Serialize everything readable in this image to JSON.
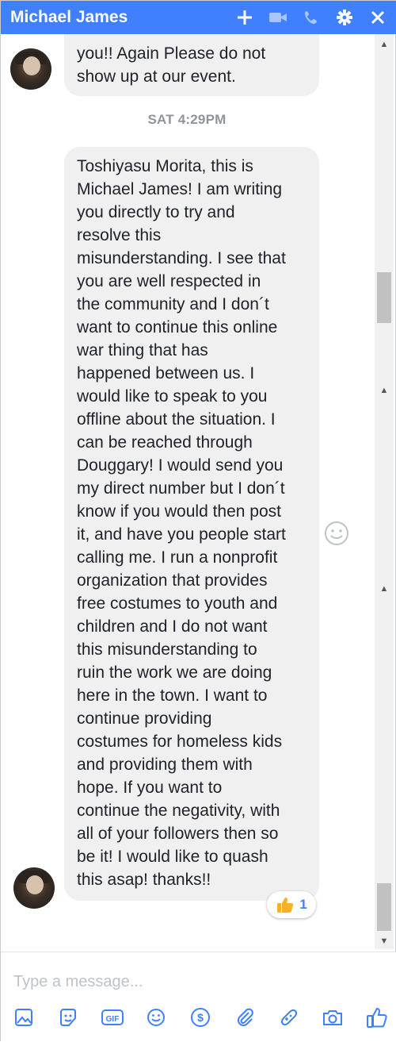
{
  "header": {
    "title": "Michael James",
    "icons": [
      "add-icon",
      "video-call-icon",
      "phone-call-icon",
      "settings-gear-icon",
      "close-icon"
    ]
  },
  "colors": {
    "header_bg": "#4080ff",
    "bubble_bg": "#f1f0f0",
    "accent": "#4080ff",
    "timestamp": "#90949c"
  },
  "conversation": {
    "previous_message": "you!! Again Please do not\nshow up at our event.",
    "timestamp": "SAT 4:29PM",
    "main_message": "Toshiyasu Morita, this is\nMichael James! I am writing\nyou directly to try and\nresolve this\nmisunderstanding. I see that\nyou are well respected in\nthe community and I don´t\nwant to continue this online\nwar thing that has\nhappened between us. I\nwould like to speak to you\noffline about the situation. I\ncan be reached through\nDouggary! I would send you\nmy direct number but I don´t\nknow if you would then post\nit, and have you people start\ncalling me. I run a nonprofit\norganization that provides\nfree costumes to youth and\nchildren and I do not want\nthis misunderstanding to\nruin the work we are doing\nhere in the town. I want to\ncontinue providing\ncostumes for homeless kids\nand providing them with\nhope. If you want to\ncontinue the negativity, with\nall of your followers then so\nbe it! I would like to quash\nthis asap! thanks!!",
    "reaction": {
      "icon": "thumbs-up-reaction-icon",
      "count": "1"
    }
  },
  "composer": {
    "placeholder": "Type a message...",
    "tools": [
      "photo-icon",
      "sticker-icon",
      "gif-icon",
      "emoji-icon",
      "payment-dollar-icon",
      "attachment-icon",
      "games-icon",
      "camera-icon",
      "like-thumb-icon"
    ]
  }
}
